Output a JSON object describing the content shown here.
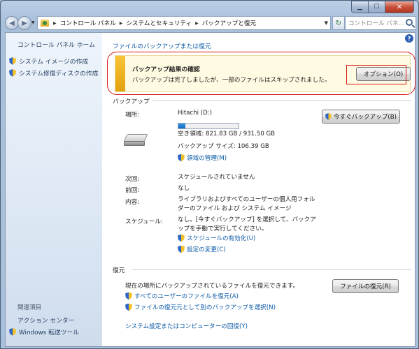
{
  "address_bar": {
    "crumbs": [
      "コントロール パネル",
      "システムとセキュリティ",
      "バックアップと復元"
    ],
    "search_placeholder": "コントロール パネ..."
  },
  "sidebar": {
    "home": "コントロール パネル ホーム",
    "tasks": [
      "システム イメージの作成",
      "システム修復ディスクの作成"
    ],
    "related_heading": "関連項目",
    "related_links": [
      "アクション センター",
      "Windows 転送ツール"
    ]
  },
  "main": {
    "top_link": "ファイルのバックアップまたは復元",
    "banner": {
      "title": "バックアップ結果の確認",
      "message": "バックアップは完了しましたが、一部のファイルはスキップされました。",
      "button": "オプション(O)"
    },
    "backup": {
      "heading": "バックアップ",
      "location_label": "場所:",
      "location_value": "Hitachi (D:)",
      "free_space": "空き領域: 821.83 GB / 931.50 GB",
      "used_fraction": 0.118,
      "backup_size": "バックアップ サイズ: 106.39 GB",
      "manage_space": "領域の管理(M)",
      "backup_now_button": "今すぐバックアップ(B)",
      "next_label": "次回:",
      "next_value": "スケジュールされていません",
      "last_label": "前回:",
      "last_value": "なし",
      "contents_label": "内容:",
      "contents_value_1": "ライブラリおよびすべてのユーザーの個人用フォル",
      "contents_value_2": "ダーのファイル および システム イメージ",
      "schedule_label": "スケジュール:",
      "schedule_value_1": "なし。[今すぐバックアップ] を選択して、バックア",
      "schedule_value_2": "ップを手動で実行してください。",
      "enable_schedule": "スケジュールの有効化(U)",
      "change_settings": "設定の変更(C)"
    },
    "restore": {
      "heading": "復元",
      "description": "現在の場所にバックアップされているファイルを復元できます。",
      "restore_button": "ファイルの復元(R)",
      "restore_all_users": "すべてのユーザーのファイルを復元(A)",
      "select_other_backup": "ファイルの復元元として別のバックアップを選択(N)",
      "recover_system": "システム設定またはコンピューターの回復(Y)"
    }
  }
}
